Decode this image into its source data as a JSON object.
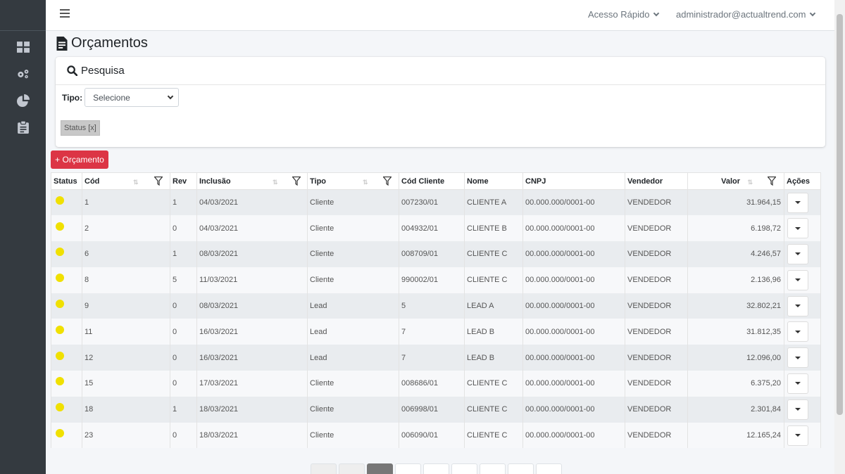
{
  "topbar": {
    "quick_access": "Acesso Rápido",
    "user": "administrador@actualtrend.com"
  },
  "page": {
    "title": "Orçamentos"
  },
  "search": {
    "title": "Pesquisa",
    "tipo_label": "Tipo:",
    "tipo_value": "Selecione",
    "status_tag": "Status [x]"
  },
  "actions": {
    "add_label": "+ Orçamento"
  },
  "table": {
    "headers": {
      "status": "Status",
      "cod": "Cód",
      "rev": "Rev",
      "inclusao": "Inclusão",
      "tipo": "Tipo",
      "cod_cliente": "Cód Cliente",
      "nome": "Nome",
      "cnpj": "CNPJ",
      "vendedor": "Vendedor",
      "valor": "Valor",
      "acoes": "Ações"
    },
    "rows": [
      {
        "cod": "1",
        "rev": "1",
        "inclusao": "04/03/2021",
        "tipo": "Cliente",
        "cod_cliente": "007230/01",
        "nome": "CLIENTE A",
        "cnpj": "00.000.000/0001-00",
        "vendedor": "VENDEDOR",
        "valor": "31.964,15"
      },
      {
        "cod": "2",
        "rev": "0",
        "inclusao": "04/03/2021",
        "tipo": "Cliente",
        "cod_cliente": "004932/01",
        "nome": "CLIENTE B",
        "cnpj": "00.000.000/0001-00",
        "vendedor": "VENDEDOR",
        "valor": "6.198,72"
      },
      {
        "cod": "6",
        "rev": "1",
        "inclusao": "08/03/2021",
        "tipo": "Cliente",
        "cod_cliente": "008709/01",
        "nome": "CLIENTE C",
        "cnpj": "00.000.000/0001-00",
        "vendedor": "VENDEDOR",
        "valor": "4.246,57"
      },
      {
        "cod": "8",
        "rev": "5",
        "inclusao": "11/03/2021",
        "tipo": "Cliente",
        "cod_cliente": "990002/01",
        "nome": "CLIENTE C",
        "cnpj": "00.000.000/0001-00",
        "vendedor": "VENDEDOR",
        "valor": "2.136,96"
      },
      {
        "cod": "9",
        "rev": "0",
        "inclusao": "08/03/2021",
        "tipo": "Lead",
        "cod_cliente": "5",
        "nome": "LEAD A",
        "cnpj": "00.000.000/0001-00",
        "vendedor": "VENDEDOR",
        "valor": "32.802,21"
      },
      {
        "cod": "11",
        "rev": "0",
        "inclusao": "16/03/2021",
        "tipo": "Lead",
        "cod_cliente": "7",
        "nome": "LEAD B",
        "cnpj": "00.000.000/0001-00",
        "vendedor": "VENDEDOR",
        "valor": "31.812,35"
      },
      {
        "cod": "12",
        "rev": "0",
        "inclusao": "16/03/2021",
        "tipo": "Lead",
        "cod_cliente": "7",
        "nome": "LEAD B",
        "cnpj": "00.000.000/0001-00",
        "vendedor": "VENDEDOR",
        "valor": "12.096,00"
      },
      {
        "cod": "15",
        "rev": "0",
        "inclusao": "17/03/2021",
        "tipo": "Cliente",
        "cod_cliente": "008686/01",
        "nome": "CLIENTE C",
        "cnpj": "00.000.000/0001-00",
        "vendedor": "VENDEDOR",
        "valor": "6.375,20"
      },
      {
        "cod": "18",
        "rev": "1",
        "inclusao": "18/03/2021",
        "tipo": "Cliente",
        "cod_cliente": "006998/01",
        "nome": "CLIENTE C",
        "cnpj": "00.000.000/0001-00",
        "vendedor": "VENDEDOR",
        "valor": "2.301,84"
      },
      {
        "cod": "23",
        "rev": "0",
        "inclusao": "18/03/2021",
        "tipo": "Cliente",
        "cod_cliente": "006090/01",
        "nome": "CLIENTE C",
        "cnpj": "00.000.000/0001-00",
        "vendedor": "VENDEDOR",
        "valor": "12.165,24"
      }
    ]
  },
  "colors": {
    "status_dot": "#f0e000",
    "add_button": "#dc3545",
    "sidebar": "#343a40"
  },
  "icons": {
    "sidebar": [
      "dashboard-icon",
      "gears-icon",
      "pie-chart-icon",
      "clipboard-icon"
    ],
    "title": "file-invoice-icon",
    "search": "search-icon"
  }
}
